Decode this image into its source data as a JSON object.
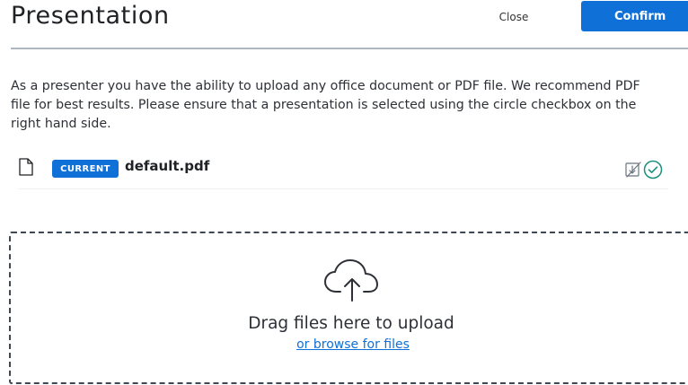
{
  "header": {
    "title": "Presentation",
    "close_label": "Close",
    "confirm_label": "Confirm"
  },
  "description": "As a presenter you have the ability to upload any office document or PDF file. We recommend PDF file for best results. Please ensure that a presentation is selected using the circle checkbox on the right hand side.",
  "description_lines": [
    "As a presenter you have the ability to upload any office document or PDF file. We recommend PDF",
    "file for best results. Please ensure that a presentation is selected using the circle checkbox on the",
    "right hand side."
  ],
  "files": [
    {
      "badge": "CURRENT",
      "name": "default.pdf",
      "icon": "file-icon",
      "actions": [
        "download-toggle-icon",
        "select-check-icon"
      ]
    }
  ],
  "dropzone": {
    "icon": "cloud-upload-icon",
    "drag_text": "Drag files here to upload",
    "browse_text": "or browse for files"
  },
  "colors": {
    "accent": "#0f70d7",
    "check": "#1a8f7a",
    "divider": "#aeb6c2",
    "text": "#1f2124"
  }
}
